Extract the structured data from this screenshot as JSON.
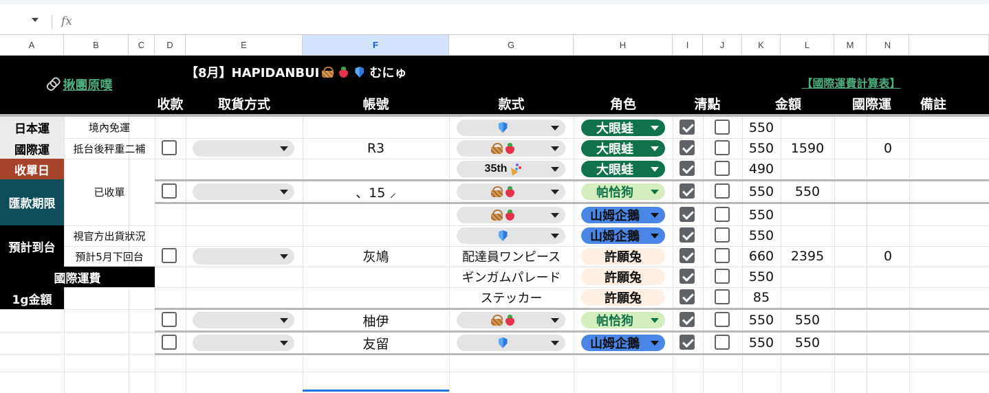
{
  "formula_bar": {
    "fx_label": "fx"
  },
  "columns": [
    "A",
    "B",
    "C",
    "D",
    "E",
    "F",
    "G",
    "H",
    "I",
    "J",
    "K",
    "L",
    "M",
    "N"
  ],
  "header": {
    "title": "【8月】HAPIDANBUI",
    "title_suffix": "むにゅ",
    "left_link": "揪團原噗",
    "right_link": "【國際運費計算表】",
    "col_labels": {
      "pay": "收款",
      "pickup": "取貨方式",
      "account": "帳號",
      "style": "款式",
      "character": "角色",
      "check": "清點",
      "amount": "金額",
      "intl": "國際運",
      "note": "備註"
    }
  },
  "side_panel": {
    "jp_ship_label": "日本運",
    "jp_ship_value": "境內免運",
    "intl_label": "國際運",
    "intl_value": "抵台後秤重二補",
    "close_label": "收單日",
    "close_value": "已收單",
    "pay_label": "匯款期限",
    "arrive_label": "預計到台",
    "arrive_value1": "視官方出貨狀況",
    "arrive_value2": "預計5月下回台",
    "fee_label": "國際運費",
    "gram_label": "1g金額"
  },
  "orders": [
    {
      "account": "R3",
      "total": "1590",
      "intl": "0",
      "items": [
        {
          "style_text": "",
          "icons": [
            "shield"
          ],
          "character": "大眼蛙",
          "amount": "550"
        },
        {
          "style_text": "",
          "icons": [
            "basket",
            "berry"
          ],
          "character": "大眼蛙",
          "amount": "550"
        },
        {
          "style_text": "35th",
          "icons": [
            "party"
          ],
          "character": "大眼蛙",
          "amount": "490"
        }
      ]
    },
    {
      "account": "、15 ⸝",
      "total": "550",
      "items": [
        {
          "style_text": "",
          "icons": [
            "basket",
            "berry"
          ],
          "character": "帕恰狗",
          "amount": "550"
        }
      ]
    },
    {
      "account": "灰鳩",
      "total": "2395",
      "intl": "0",
      "items": [
        {
          "style_text": "",
          "icons": [
            "basket",
            "berry"
          ],
          "character": "山姆企鵝",
          "amount": "550"
        },
        {
          "style_text": "",
          "icons": [
            "shield"
          ],
          "character": "山姆企鵝",
          "amount": "550"
        },
        {
          "style_text": "配達員ワンピース",
          "icons": [],
          "character": "許願兔",
          "amount": "660"
        },
        {
          "style_text": "ギンガムパレード",
          "icons": [],
          "character": "許願兔",
          "amount": "550"
        },
        {
          "style_text": "ステッカー",
          "icons": [],
          "character": "許願兔",
          "amount": "85"
        }
      ]
    },
    {
      "account": "柚伊",
      "total": "550",
      "items": [
        {
          "style_text": "",
          "icons": [
            "basket",
            "berry"
          ],
          "character": "帕恰狗",
          "amount": "550"
        }
      ]
    },
    {
      "account": "友留",
      "total": "550",
      "items": [
        {
          "style_text": "",
          "icons": [
            "shield"
          ],
          "character": "山姆企鵝",
          "amount": "550"
        }
      ]
    }
  ],
  "colors": {
    "frog": "#11734b",
    "pochacco": "#d4edbc",
    "penguin": "#4a86e8",
    "bunny": "#ffefe3",
    "close_red": "#a6432a",
    "pay_teal": "#0e4e5a",
    "header_black": "#000000"
  }
}
